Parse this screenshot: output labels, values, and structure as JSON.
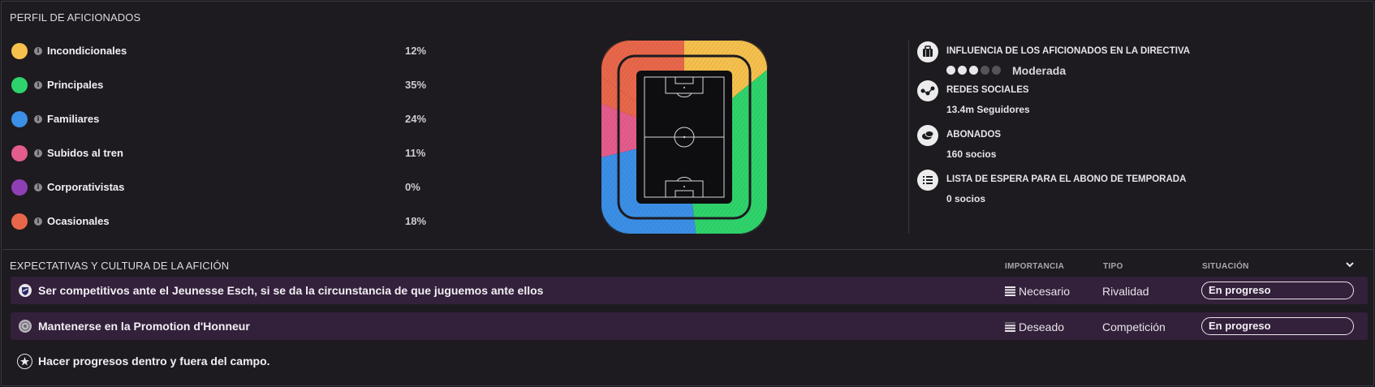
{
  "fan_profile": {
    "title": "PERFIL DE AFICIONADOS",
    "groups": [
      {
        "name": "Incondicionales",
        "pct": "12%",
        "color": "#f5c04d"
      },
      {
        "name": "Principales",
        "pct": "35%",
        "color": "#2fd36b"
      },
      {
        "name": "Familiares",
        "pct": "24%",
        "color": "#3b8fe6"
      },
      {
        "name": "Subidos al tren",
        "pct": "11%",
        "color": "#e45c8c"
      },
      {
        "name": "Corporativistas",
        "pct": "0%",
        "color": "#8f3fb5"
      },
      {
        "name": "Ocasionales",
        "pct": "18%",
        "color": "#e8674a"
      }
    ],
    "info_icon": "info-icon"
  },
  "club_info": {
    "board_influence": {
      "label": "INFLUENCIA DE LOS AFICIONADOS EN LA DIRECTIVA",
      "level": 3,
      "max": 5,
      "value": "Moderada",
      "icon": "briefcase-icon"
    },
    "social": {
      "label": "REDES SOCIALES",
      "value": "13.4m Seguidores",
      "icon": "network-icon"
    },
    "season_ticket": {
      "label": "ABONADOS",
      "value": "160 socios",
      "icon": "ticket-icon"
    },
    "waiting_list": {
      "label": "LISTA DE ESPERA PARA EL ABONO DE TEMPORADA",
      "value": "0 socios",
      "icon": "list-icon"
    }
  },
  "expectations": {
    "title": "EXPECTATIVAS Y CULTURA DE LA AFICIÓN",
    "columns": {
      "importance": "IMPORTANCIA",
      "type": "TIPO",
      "status": "SITUACIÓN"
    },
    "rows": [
      {
        "text": "Ser competitivos ante el Jeunesse Esch, si se da la circunstancia de que juguemos ante ellos",
        "importance": "Necesario",
        "type": "Rivalidad",
        "status": "En progreso",
        "icon": "club-crest-icon"
      },
      {
        "text": "Mantenerse en la Promotion d'Honneur",
        "importance": "Deseado",
        "type": "Competición",
        "status": "En progreso",
        "icon": "league-badge-icon"
      },
      {
        "text": "Hacer progresos dentro y fuera del campo.",
        "icon": "star-icon"
      }
    ]
  },
  "colors": {
    "background": "#1d1b20",
    "highlight_row": "#33203a",
    "divider": "#3a3740"
  }
}
